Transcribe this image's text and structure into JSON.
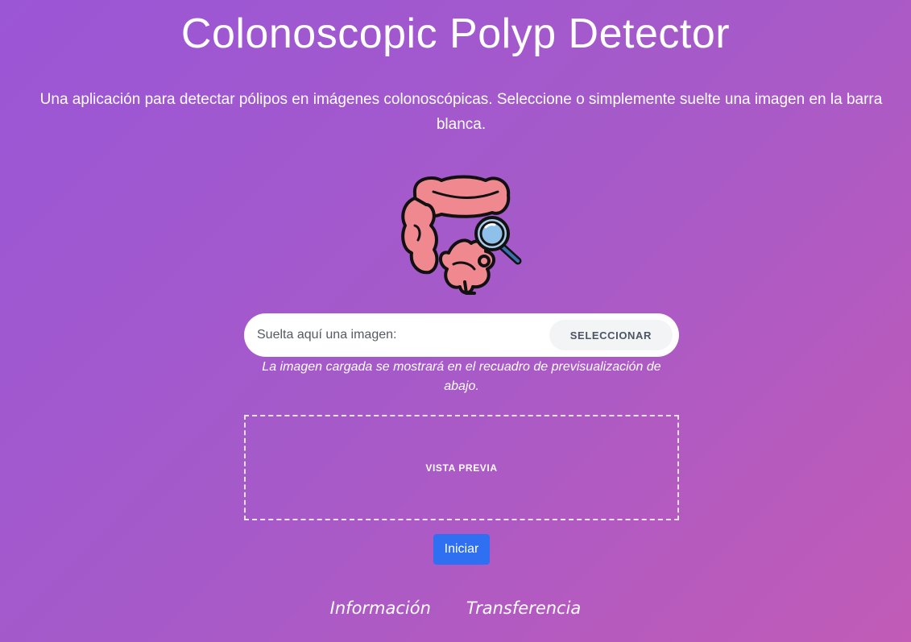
{
  "page": {
    "title": "Colonoscopic Polyp Detector",
    "subtitle": "Una aplicación para detectar pólipos en imágenes colonoscópicas. Seleccione o simplemente suelte una imagen en la barra blanca."
  },
  "logo": {
    "icon": "colon-magnifier-icon"
  },
  "upload": {
    "placeholder": "Suelta aquí una imagen:",
    "select_label": "SELECCIONAR",
    "hint": "La imagen cargada se mostrará en el recuadro de previsualización de abajo."
  },
  "preview": {
    "label": "VISTA PREVIA"
  },
  "actions": {
    "start_label": "Iniciar"
  },
  "footer": {
    "links": [
      {
        "label": "Información"
      },
      {
        "label": "Transferencia"
      }
    ]
  },
  "colors": {
    "background_start": "#9b56d6",
    "background_end": "#c15bb7",
    "primary_button": "#2f6ff2"
  }
}
